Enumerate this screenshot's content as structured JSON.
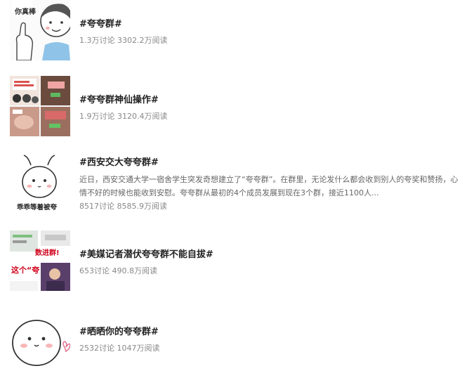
{
  "topics": [
    {
      "title": "#夸夸群#",
      "stats": "1.3万讨论 3302.2万阅读",
      "thumb_text": "你真棒"
    },
    {
      "title": "#夸夸群神仙操作#",
      "stats": "1.9万讨论 3120.4万阅读"
    },
    {
      "title": "#西安交大夸夸群#",
      "desc": "近日，西安交通大学一宿舍学生突发奇想建立了“夸夸群”。在群里，无论发什么都会收到别人的夸奖和赞扬，心情不好的时候也能收到安慰。夸夸群从最初的4个成员发展到现在3个群，接近1100人...",
      "stats": "8517讨论 8585.9万阅读",
      "thumb_text": "乖乖等着被夸"
    },
    {
      "title": "#美媒记者潜伏夸夸群不能自拔#",
      "stats": "653讨论 490.8万阅读",
      "thumb_text_1": "数进群!",
      "thumb_text_2": "这个“夸"
    },
    {
      "title": "#晒晒你的夸夸群#",
      "stats": "2532讨论 1047万阅读"
    }
  ],
  "colors": {
    "title": "#222222",
    "meta": "#888888",
    "desc": "#666666"
  }
}
